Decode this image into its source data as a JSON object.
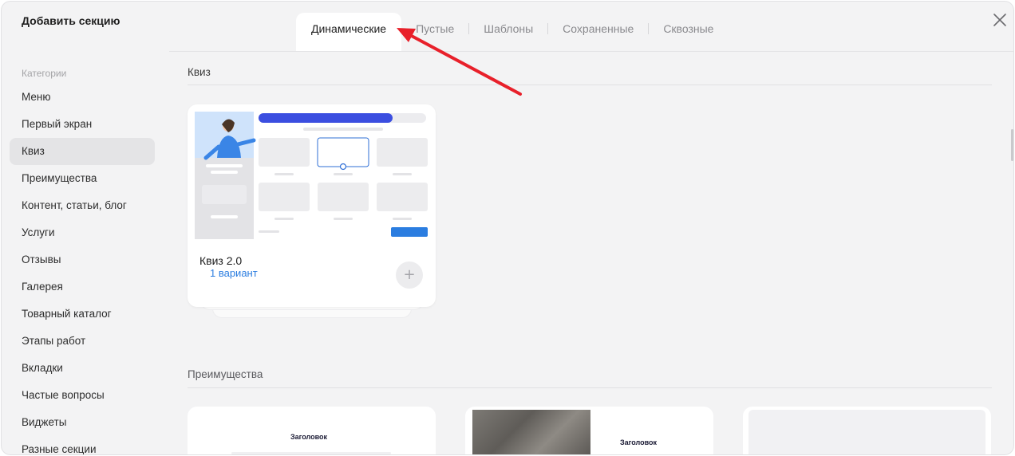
{
  "header": {
    "title": "Добавить секцию",
    "tabs": [
      {
        "label": "Динамические",
        "active": true
      },
      {
        "label": "Пустые",
        "active": false
      },
      {
        "label": "Шаблоны",
        "active": false
      },
      {
        "label": "Сохраненные",
        "active": false
      },
      {
        "label": "Сквозные",
        "active": false
      }
    ],
    "close_icon": "close-icon"
  },
  "sidebar": {
    "heading": "Категории",
    "items": [
      {
        "label": "Меню"
      },
      {
        "label": "Первый экран"
      },
      {
        "label": "Квиз",
        "active": true
      },
      {
        "label": "Преимущества"
      },
      {
        "label": "Контент, статьи, блог"
      },
      {
        "label": "Услуги"
      },
      {
        "label": "Отзывы"
      },
      {
        "label": "Галерея"
      },
      {
        "label": "Товарный каталог"
      },
      {
        "label": "Этапы работ"
      },
      {
        "label": "Вкладки"
      },
      {
        "label": "Частые вопросы"
      },
      {
        "label": "Виджеты"
      },
      {
        "label": "Разные секции"
      }
    ]
  },
  "main": {
    "sections": [
      {
        "title": "Квиз",
        "cards": [
          {
            "name": "Квиз 2.0",
            "variants": "1 вариант",
            "add_icon": "plus-icon"
          }
        ]
      },
      {
        "title": "Преимущества",
        "cards": [
          {
            "preview_heading": "Заголовок"
          },
          {
            "preview_heading": "Заголовок"
          },
          {
            "preview_heading": ""
          }
        ]
      }
    ]
  },
  "colors": {
    "accent_blue": "#2b7de0",
    "arrow_red": "#e8202a",
    "active_category_bg": "#e4e4e6",
    "modal_bg": "#f3f3f4"
  }
}
